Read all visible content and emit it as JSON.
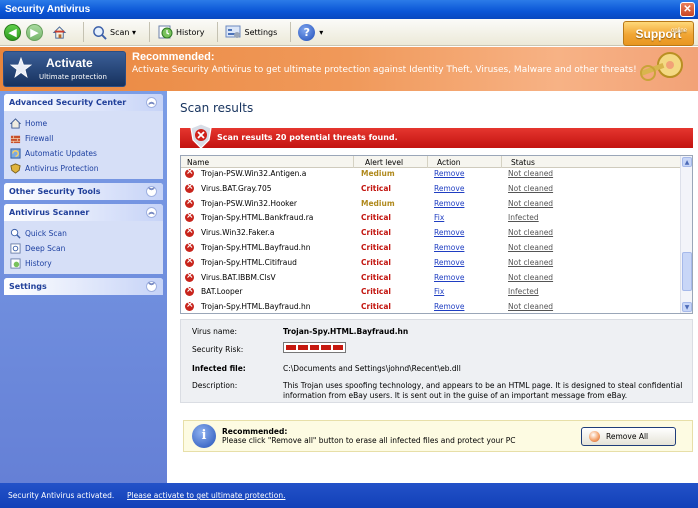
{
  "window": {
    "title": "Security Antivirus",
    "close_glyph": "✕"
  },
  "toolbar": {
    "back_glyph": "◀",
    "forward_glyph": "▶",
    "items": [
      {
        "label": "Scan ▾",
        "icon": "search-icon"
      },
      {
        "label": "History",
        "icon": "history-icon"
      },
      {
        "label": "Settings",
        "icon": "settings-icon"
      }
    ],
    "help_glyph": "?",
    "help_arrow": "▾"
  },
  "support": {
    "label": "Support",
    "status": "online"
  },
  "banner": {
    "activate_title": "Activate",
    "activate_sub": "Ultimate protection",
    "rec_title": "Recommended:",
    "rec_text": "Activate Security Antivirus to get ultimate protection against Identity Theft, Viruses, Malware and other threats!"
  },
  "sidebar": {
    "panels": [
      {
        "title": "Advanced Security Center",
        "chevron": "︽",
        "items": [
          "Home",
          "Firewall",
          "Automatic Updates",
          "Antivirus Protection"
        ]
      },
      {
        "title": "Other Security Tools",
        "chevron": "︾",
        "items": []
      },
      {
        "title": "Antivirus Scanner",
        "chevron": "︽",
        "items": [
          "Quick Scan",
          "Deep Scan",
          "History"
        ]
      },
      {
        "title": "Settings",
        "chevron": "︾",
        "items": []
      }
    ]
  },
  "main": {
    "title": "Scan results",
    "alert": "Scan results 20 potential threats found.",
    "columns": [
      "Name",
      "Alert level",
      "Action",
      "Status"
    ],
    "rows": [
      {
        "name": "Trojan-PSW.Win32.Antigen.a",
        "level": "Medium",
        "action": "Remove",
        "status": "Not cleaned"
      },
      {
        "name": "Virus.BAT.Gray.705",
        "level": "Critical",
        "action": "Remove",
        "status": "Not cleaned"
      },
      {
        "name": "Trojan-PSW.Win32.Hooker",
        "level": "Medium",
        "action": "Remove",
        "status": "Not cleaned"
      },
      {
        "name": "Trojan-Spy.HTML.Bankfraud.ra",
        "level": "Critical",
        "action": "Fix",
        "status": "Infected"
      },
      {
        "name": "Virus.Win32.Faker.a",
        "level": "Critical",
        "action": "Remove",
        "status": "Not cleaned"
      },
      {
        "name": "Trojan-Spy.HTML.Bayfraud.hn",
        "level": "Critical",
        "action": "Remove",
        "status": "Not cleaned"
      },
      {
        "name": "Trojan-Spy.HTML.Citifraud",
        "level": "Critical",
        "action": "Remove",
        "status": "Not cleaned"
      },
      {
        "name": "Virus.BAT.IBBM.ClsV",
        "level": "Critical",
        "action": "Remove",
        "status": "Not cleaned"
      },
      {
        "name": "BAT.Looper",
        "level": "Critical",
        "action": "Fix",
        "status": "Infected"
      },
      {
        "name": "Trojan-Spy.HTML.Bayfraud.hn",
        "level": "Critical",
        "action": "Remove",
        "status": "Not cleaned"
      }
    ],
    "scroll_up": "▲",
    "scroll_down": "▼"
  },
  "details": {
    "virus_label": "Virus name:",
    "virus_value": "Trojan-Spy.HTML.Bayfraud.hn",
    "risk_label": "Security Risk:",
    "risk_level": 5,
    "file_label": "Infected file:",
    "file_value": "C:\\Documents and Settings\\johnd\\Recent\\eb.dll",
    "desc_label": "Description:",
    "desc_line1": "This Trojan uses spoofing technology, and appears to be an HTML page. It is designed to steal confidential",
    "desc_line2": "information from eBay users. It is sent out in the guise of an important message from eBay."
  },
  "recommend": {
    "icon_glyph": "i",
    "title": "Recommended:",
    "text": "Please click \"Remove all\" button to erase all infected files and protect your PC",
    "button": "Remove All"
  },
  "status": {
    "text": "Security Antivirus activated.",
    "link": "Please activate to get ultimate protection."
  }
}
